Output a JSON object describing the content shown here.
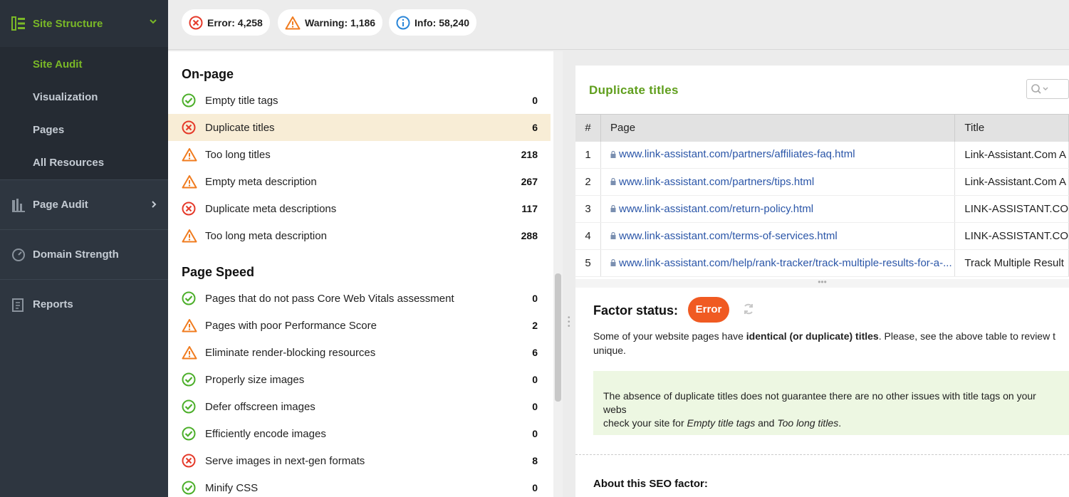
{
  "sidebar": {
    "header": "Site Structure",
    "subitems": [
      "Site Audit",
      "Visualization",
      "Pages",
      "All Resources"
    ],
    "items": [
      "Page Audit",
      "Domain Strength",
      "Reports"
    ]
  },
  "badges": {
    "error": "Error: 4,258",
    "warning": "Warning: 1,186",
    "info": "Info: 58,240"
  },
  "left": {
    "section1": "On-page",
    "onpage": [
      {
        "name": "Empty title tags",
        "count": "0",
        "status": "ok"
      },
      {
        "name": "Duplicate titles",
        "count": "6",
        "status": "error"
      },
      {
        "name": "Too long titles",
        "count": "218",
        "status": "warning"
      },
      {
        "name": "Empty meta description",
        "count": "267",
        "status": "warning"
      },
      {
        "name": "Duplicate meta descriptions",
        "count": "117",
        "status": "error"
      },
      {
        "name": "Too long meta description",
        "count": "288",
        "status": "warning"
      }
    ],
    "section2": "Page Speed",
    "speed": [
      {
        "name": "Pages that do not pass Core Web Vitals assessment",
        "count": "0",
        "status": "ok"
      },
      {
        "name": "Pages with poor Performance Score",
        "count": "2",
        "status": "warning"
      },
      {
        "name": "Eliminate render-blocking resources",
        "count": "6",
        "status": "warning"
      },
      {
        "name": "Properly size images",
        "count": "0",
        "status": "ok"
      },
      {
        "name": "Defer offscreen images",
        "count": "0",
        "status": "ok"
      },
      {
        "name": "Efficiently encode images",
        "count": "0",
        "status": "ok"
      },
      {
        "name": "Serve images in next-gen formats",
        "count": "8",
        "status": "error"
      },
      {
        "name": "Minify CSS",
        "count": "0",
        "status": "ok"
      }
    ]
  },
  "right": {
    "title": "Duplicate titles",
    "headers": [
      "#",
      "Page",
      "Title"
    ],
    "rows": [
      {
        "n": "1",
        "page": "www.link-assistant.com/partners/affiliates-faq.html",
        "title": "Link-Assistant.Com A"
      },
      {
        "n": "2",
        "page": "www.link-assistant.com/partners/tips.html",
        "title": "Link-Assistant.Com A"
      },
      {
        "n": "3",
        "page": "www.link-assistant.com/return-policy.html",
        "title": "LINK-ASSISTANT.CO"
      },
      {
        "n": "4",
        "page": "www.link-assistant.com/terms-of-services.html",
        "title": "LINK-ASSISTANT.CO"
      },
      {
        "n": "5",
        "page": "www.link-assistant.com/help/rank-tracker/track-multiple-results-for-a-...",
        "title": "Track Multiple Result"
      }
    ],
    "factor_label": "Factor status:",
    "factor_value": "Error",
    "desc_pre": "Some of your website pages have ",
    "desc_bold": "identical (or duplicate) titles",
    "desc_post": ". Please, see the above table to review t",
    "desc_line2": "unique.",
    "note_line1": "The absence of duplicate titles does not guarantee there are no other issues with title tags on your webs",
    "note_pre": "check your site for ",
    "note_em1": "Empty title tags",
    "note_mid": " and ",
    "note_em2": "Too long titles",
    "note_end": ".",
    "about": "About this SEO factor:"
  },
  "colors": {
    "ok": "#4caf2a",
    "error": "#e53a2a",
    "warning": "#f07b1e",
    "info": "#2a86d8",
    "accent": "#7ab827"
  }
}
